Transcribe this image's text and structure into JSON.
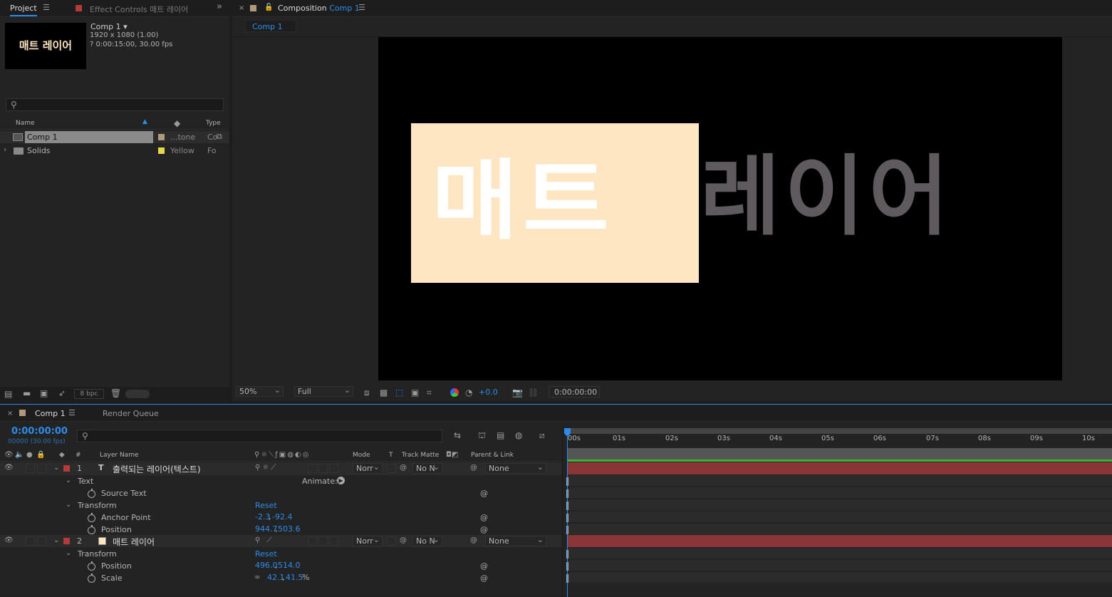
{
  "project": {
    "tab_label": "Project",
    "effect_tab_label": "Effect Controls 매트 레이어",
    "thumb_text": "매트 레이어",
    "comp_name": "Comp 1 ▾",
    "comp_res": "1920 x 1080 (1.00)",
    "comp_dur": "? 0:00:15:00, 30.00 fps",
    "search_placeholder": "",
    "col_name": "Name",
    "col_type": "Type",
    "items": [
      {
        "name": "Comp 1",
        "label": "...tone",
        "type": "Co",
        "color": "#b09a7c"
      },
      {
        "name": "Solids",
        "label": "Yellow",
        "type": "Fo",
        "color": "#e3d94a"
      }
    ],
    "bpc": "8 bpc"
  },
  "composition": {
    "tab_prefix": "Composition",
    "tab_comp": "Comp 1",
    "subtab": "Comp 1",
    "matte_text": "매트",
    "layer_text": "레이어",
    "matte_color": "#ffe6c3",
    "text_color": "#5e5a5e",
    "zoom": "50%",
    "resolution": "Full",
    "exposure": "+0.0",
    "timecode": "0:00:00:00"
  },
  "timeline": {
    "tab_label": "Comp 1",
    "render_queue": "Render Queue",
    "timecode": "0:00:00:00",
    "frames": "00000 (30.00 fps)",
    "cols": {
      "num": "#",
      "layer_name": "Layer Name",
      "mode": "Mode",
      "t": "T",
      "track_matte": "Track Matte",
      "parent": "Parent & Link"
    },
    "ruler": [
      "00s",
      "01s",
      "02s",
      "03s",
      "04s",
      "05s",
      "06s",
      "07s",
      "08s",
      "09s",
      "10s"
    ],
    "layer1": {
      "num": "1",
      "type_icon": "T",
      "name": "출력되는 레이어(텍스트)",
      "mode": "Norr",
      "matte": "No N",
      "parent": "None",
      "color": "#b53a3a",
      "text_group": "Text",
      "animate": "Animate:",
      "source_text": "Source Text",
      "transform": "Transform",
      "reset": "Reset",
      "anchor_label": "Anchor Point",
      "anchor_x": "-2.3",
      "anchor_y": "-92.4",
      "position_label": "Position",
      "pos_x": "944.7",
      "pos_y": "503.6"
    },
    "layer2": {
      "num": "2",
      "name": "매트 레이어",
      "mode": "Norr",
      "matte": "No N",
      "parent": "None",
      "color": "#b53a3a",
      "transform": "Transform",
      "reset": "Reset",
      "position_label": "Position",
      "pos_x": "496.0",
      "pos_y": "514.0",
      "scale_label": "Scale",
      "scale_x": "42.1",
      "scale_y": "41.5",
      "scale_unit": "%"
    }
  }
}
